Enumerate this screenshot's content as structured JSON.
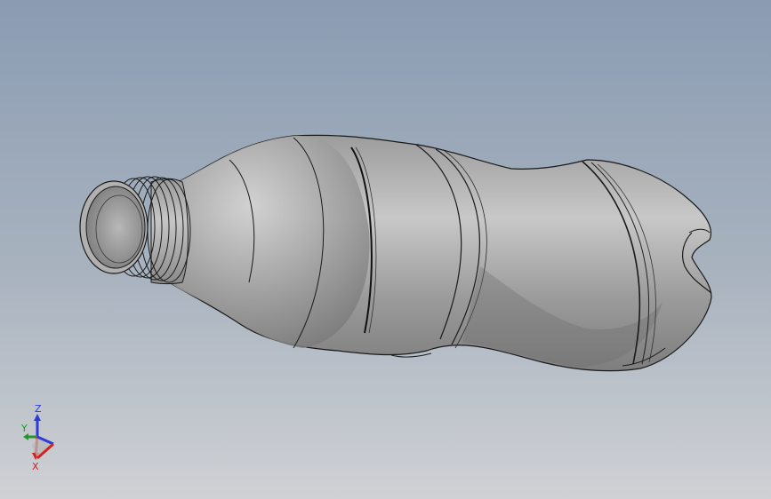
{
  "viewport": {
    "background_top": "#8a9cb2",
    "background_bottom": "#cfd1d5"
  },
  "model": {
    "part": "bottle",
    "body_color": "#a8a8a8",
    "edge_color": "#1a1a1a"
  },
  "triad": {
    "z_label": "Z",
    "y_label": "Y",
    "x_label": "X",
    "z_color": "#2b3bd6",
    "y_color": "#1f9a2a",
    "x_color": "#d42020"
  }
}
